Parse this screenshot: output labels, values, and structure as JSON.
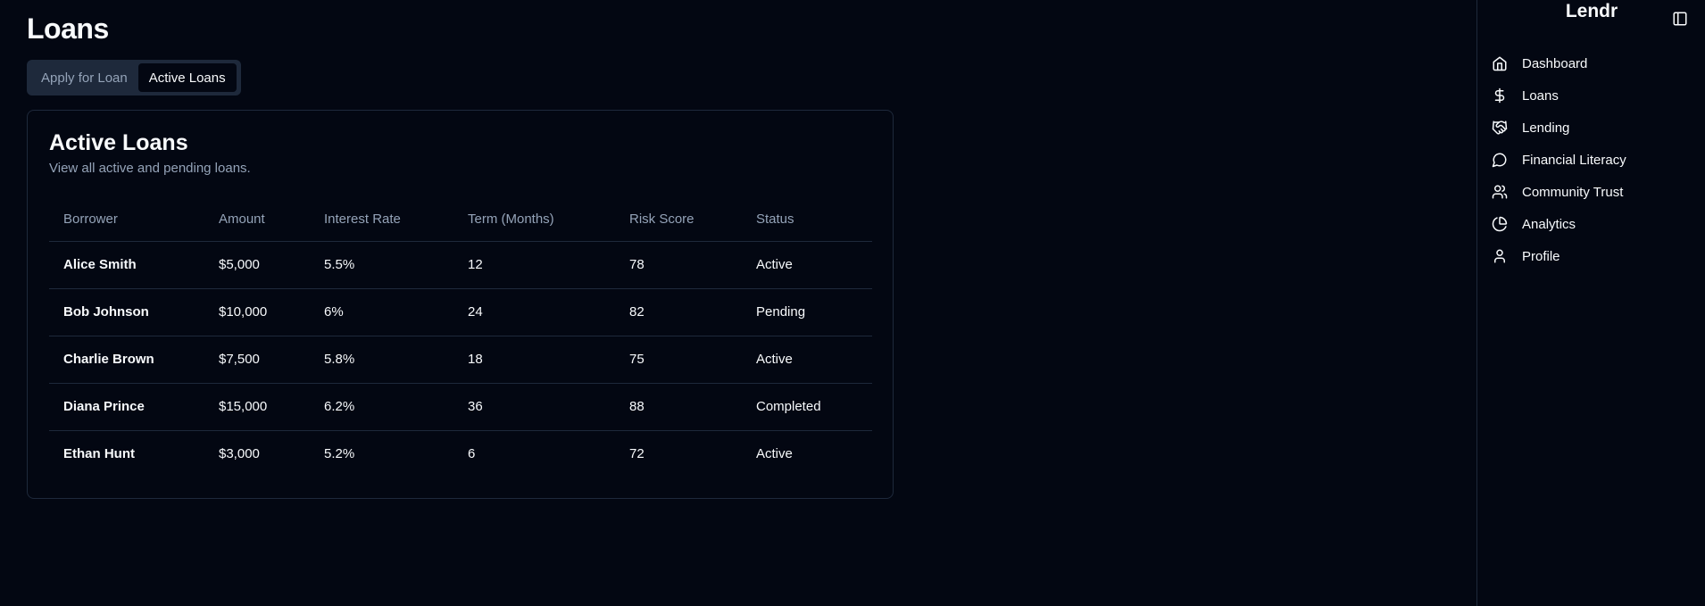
{
  "header": {
    "title": "Loans"
  },
  "tabs": [
    {
      "label": "Apply for Loan",
      "active": false
    },
    {
      "label": "Active Loans",
      "active": true
    }
  ],
  "card": {
    "title": "Active Loans",
    "subtitle": "View all active and pending loans.",
    "columns": [
      "Borrower",
      "Amount",
      "Interest Rate",
      "Term (Months)",
      "Risk Score",
      "Status"
    ],
    "rows": [
      [
        "Alice Smith",
        "$5,000",
        "5.5%",
        "12",
        "78",
        "Active"
      ],
      [
        "Bob Johnson",
        "$10,000",
        "6%",
        "24",
        "82",
        "Pending"
      ],
      [
        "Charlie Brown",
        "$7,500",
        "5.8%",
        "18",
        "75",
        "Active"
      ],
      [
        "Diana Prince",
        "$15,000",
        "6.2%",
        "36",
        "88",
        "Completed"
      ],
      [
        "Ethan Hunt",
        "$3,000",
        "5.2%",
        "6",
        "72",
        "Active"
      ]
    ]
  },
  "sidebar": {
    "brand": "Lendr",
    "items": [
      {
        "label": "Dashboard",
        "icon": "home-icon"
      },
      {
        "label": "Loans",
        "icon": "dollar-icon"
      },
      {
        "label": "Lending",
        "icon": "handshake-icon"
      },
      {
        "label": "Financial Literacy",
        "icon": "message-circle-icon"
      },
      {
        "label": "Community Trust",
        "icon": "users-icon"
      },
      {
        "label": "Analytics",
        "icon": "pie-chart-icon"
      },
      {
        "label": "Profile",
        "icon": "user-icon"
      }
    ]
  }
}
